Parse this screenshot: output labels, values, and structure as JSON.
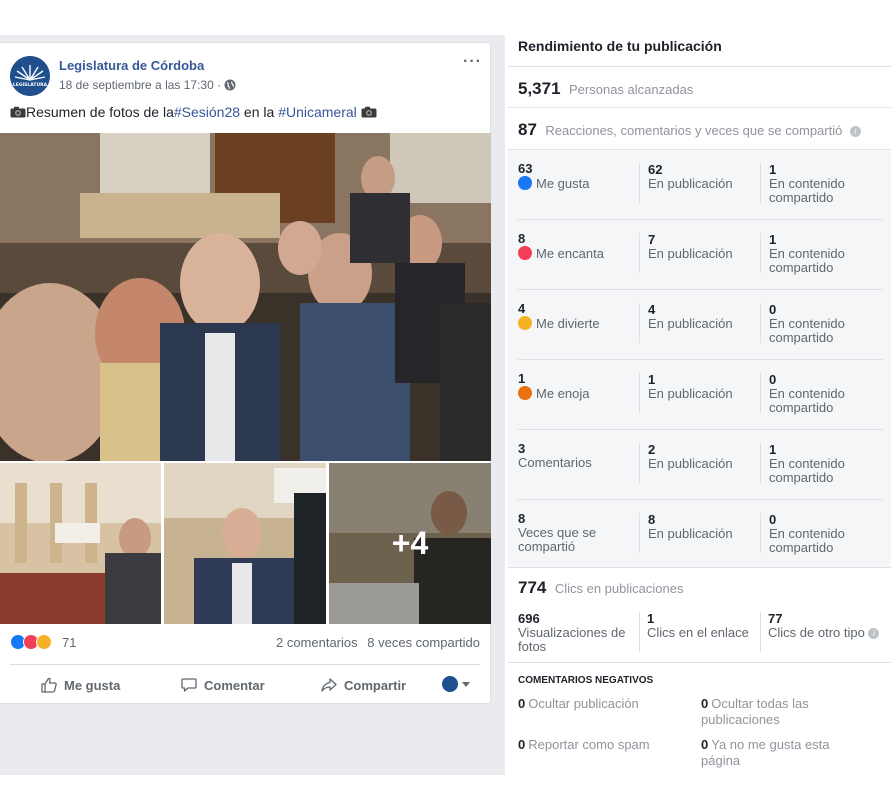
{
  "post": {
    "page_name": "Legislatura de Córdoba",
    "timestamp": "18 de septiembre a las 17:30 ·",
    "text": {
      "prefix": "Resumen de fotos de la ",
      "hashtag1": "#Sesión28",
      "middle": " en la ",
      "hashtag2": "#Unicameral"
    },
    "more_photos": "+4",
    "reactions_total": "71",
    "comments": "2 comentarios",
    "shares": "8 veces compartido",
    "actions": {
      "like": "Me gusta",
      "comment": "Comentar",
      "share": "Compartir"
    }
  },
  "panel": {
    "title": "Rendimiento de tu publicación",
    "reached": {
      "value": "5,371",
      "label": "Personas alcanzadas"
    },
    "engagement": {
      "value": "87",
      "label": "Reacciones, comentarios y veces que se compartió"
    },
    "breakdown": [
      {
        "value": "63",
        "label": "Me gusta",
        "icon": "like-icon",
        "on_post": "62",
        "on_post_label": "En publicación",
        "on_shares": "1",
        "on_shares_label": "En contenido compartido"
      },
      {
        "value": "8",
        "label": "Me encanta",
        "icon": "love-icon",
        "on_post": "7",
        "on_post_label": "En publicación",
        "on_shares": "1",
        "on_shares_label": "En contenido compartido"
      },
      {
        "value": "4",
        "label": "Me divierte",
        "icon": "haha-icon",
        "on_post": "4",
        "on_post_label": "En publicación",
        "on_shares": "0",
        "on_shares_label": "En contenido compartido"
      },
      {
        "value": "1",
        "label": "Me enoja",
        "icon": "angry-icon",
        "on_post": "1",
        "on_post_label": "En publicación",
        "on_shares": "0",
        "on_shares_label": "En contenido compartido"
      },
      {
        "value": "3",
        "label": "Comentarios",
        "icon": "",
        "on_post": "2",
        "on_post_label": "En publicación",
        "on_shares": "1",
        "on_shares_label": "En contenido compartido"
      },
      {
        "value": "8",
        "label": "Veces que se compartió",
        "icon": "",
        "on_post": "8",
        "on_post_label": "En publicación",
        "on_shares": "0",
        "on_shares_label": "En contenido compartido"
      }
    ],
    "clicks": {
      "value": "774",
      "label": "Clics en publicaciones",
      "photo_views": {
        "value": "696",
        "label": "Visualizaciones de fotos"
      },
      "link_clicks": {
        "value": "1",
        "label": "Clics en el enlace"
      },
      "other_clicks": {
        "value": "77",
        "label": "Clics de otro tipo"
      }
    },
    "negative": {
      "title": "Comentarios negativos",
      "hide_post": {
        "value": "0",
        "label": "Ocultar publicación"
      },
      "hide_all": {
        "value": "0",
        "label": "Ocultar todas las publicaciones"
      },
      "report_spam": {
        "value": "0",
        "label": "Reportar como spam"
      },
      "unlike_page": {
        "value": "0",
        "label": "Ya no me gusta esta página"
      }
    }
  },
  "colors": {
    "link_blue": "#365899",
    "like_blue": "#1877f2",
    "love_red": "#f33e58",
    "haha_yellow": "#f7b125",
    "angry_orange": "#e9710f"
  }
}
